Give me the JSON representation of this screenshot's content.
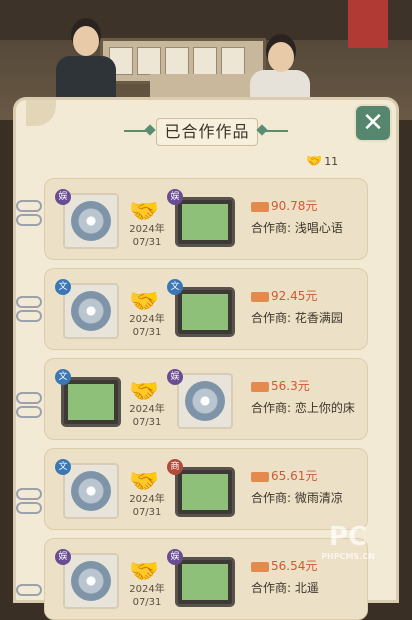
{
  "header": {
    "title": "已合作作品",
    "close_label": "✕",
    "handshake_icon": "handshake-icon",
    "count": "11"
  },
  "works": [
    {
      "left_type": "disc",
      "left_badge": "娱",
      "right_type": "tv",
      "right_badge": "娱",
      "year": "2024年",
      "date": "07/31",
      "money": "90.78元",
      "partner_label": "合作商:",
      "partner": "浅唱心语"
    },
    {
      "left_type": "disc",
      "left_badge": "文",
      "right_type": "tv",
      "right_badge": "文",
      "year": "2024年",
      "date": "07/31",
      "money": "92.45元",
      "partner_label": "合作商:",
      "partner": "花香满园"
    },
    {
      "left_type": "tv",
      "left_badge": "文",
      "right_type": "disc",
      "right_badge": "娱",
      "year": "2024年",
      "date": "07/31",
      "money": "56.3元",
      "partner_label": "合作商:",
      "partner": "恋上你的床"
    },
    {
      "left_type": "disc",
      "left_badge": "文",
      "right_type": "tv",
      "right_badge": "商",
      "year": "2024年",
      "date": "07/31",
      "money": "65.61元",
      "partner_label": "合作商:",
      "partner": "微雨清凉"
    },
    {
      "left_type": "disc",
      "left_badge": "娱",
      "right_type": "tv",
      "right_badge": "娱",
      "year": "2024年",
      "date": "07/31",
      "money": "56.54元",
      "partner_label": "合作商:",
      "partner": "北遥"
    }
  ],
  "watermark": {
    "text": "PC",
    "sub": "PHPCMS.CN"
  },
  "colors": {
    "accent": "#5b8d70",
    "money": "#cf5a32",
    "panel": "#f3ead6"
  }
}
